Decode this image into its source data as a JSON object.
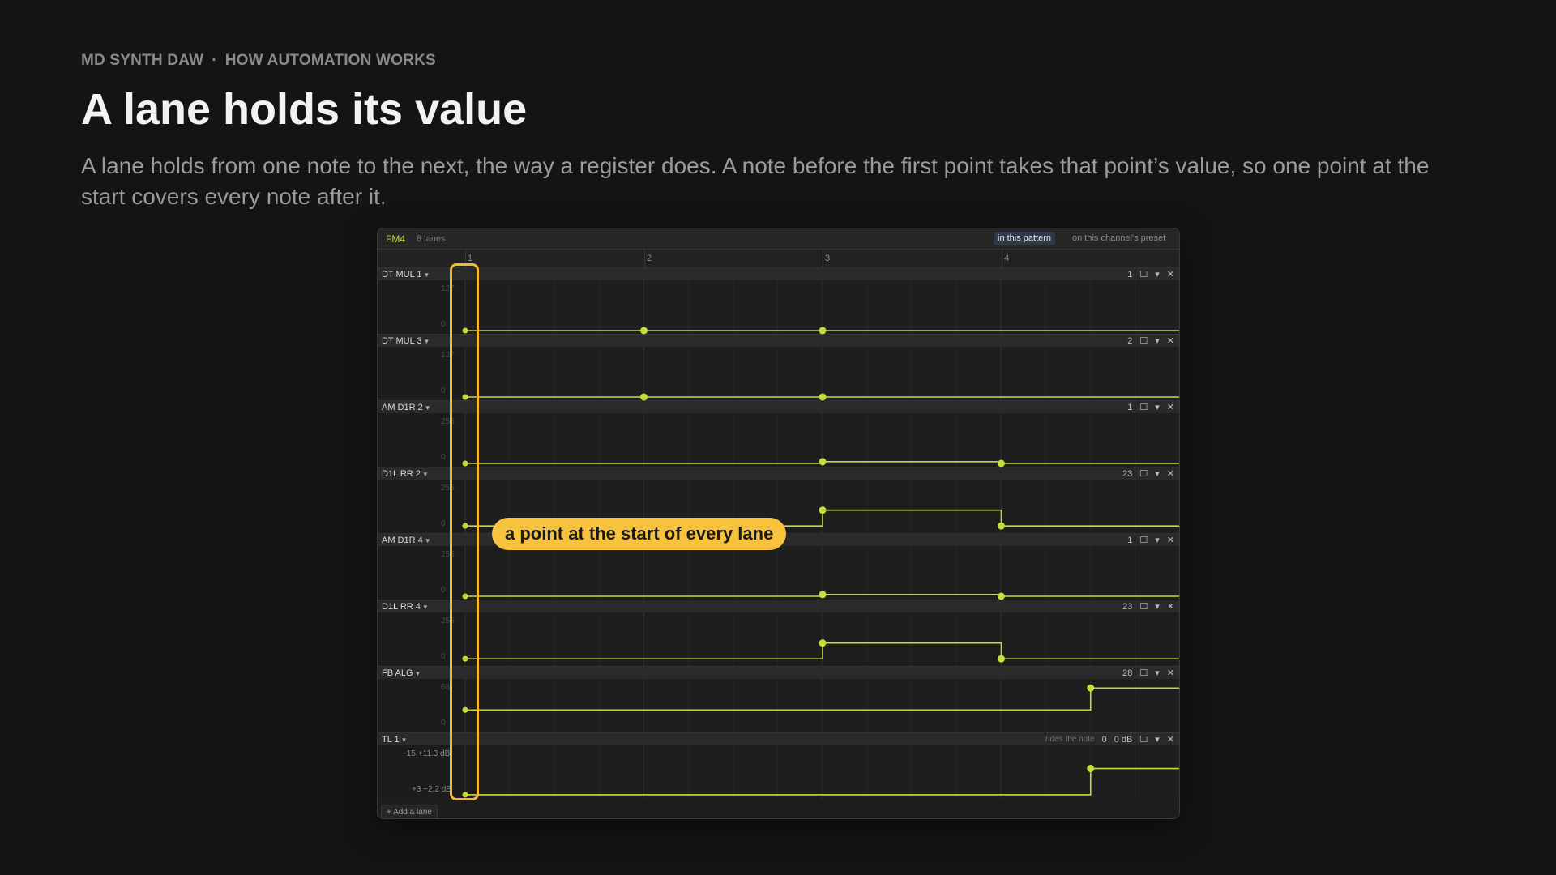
{
  "eyebrow": {
    "app": "MD SYNTH DAW",
    "sep": "·",
    "section": "HOW AUTOMATION WORKS"
  },
  "title": "A lane holds its value",
  "subtitle": "A lane holds from one note to the next, the way a register does. A note before the first point takes that point’s value, so one point at the start covers every note after it.",
  "panel": {
    "channel": "FM4",
    "lane_count": "8 lanes",
    "scope_active": "in this pattern",
    "scope_other": "on this channel's preset",
    "bars": [
      "1",
      "2",
      "3",
      "4"
    ],
    "add_lane": "+ Add a lane"
  },
  "colors": {
    "accent": "#c8dc3a",
    "callout": "#f7c23e",
    "background": "#141414"
  },
  "icons": {
    "dropdown": "caret-down-icon",
    "toggle": "square-icon",
    "menu": "chevron-down-icon",
    "remove": "close-icon"
  },
  "lanes": [
    {
      "name": "DT MUL 1",
      "val": "1",
      "max": "127",
      "min": "0",
      "points": [
        [
          1.0,
          0
        ],
        [
          2.0,
          0
        ],
        [
          3.0,
          0
        ]
      ]
    },
    {
      "name": "DT MUL 3",
      "val": "2",
      "max": "127",
      "min": "0",
      "points": [
        [
          1.0,
          0
        ],
        [
          2.0,
          0
        ],
        [
          3.0,
          0
        ]
      ]
    },
    {
      "name": "AM D1R 2",
      "val": "1",
      "max": "255",
      "min": "0",
      "points": [
        [
          1.0,
          0
        ],
        [
          3.0,
          0.04
        ],
        [
          4.0,
          0
        ]
      ]
    },
    {
      "name": "D1L RR 2",
      "val": "23",
      "max": "255",
      "min": "0",
      "points": [
        [
          1.0,
          0.09
        ],
        [
          3.0,
          0.45
        ],
        [
          4.0,
          0.09
        ]
      ]
    },
    {
      "name": "AM D1R 4",
      "val": "1",
      "max": "255",
      "min": "0",
      "points": [
        [
          1.0,
          0
        ],
        [
          3.0,
          0.04
        ],
        [
          4.0,
          0
        ]
      ]
    },
    {
      "name": "D1L RR 4",
      "val": "23",
      "max": "255",
      "min": "0",
      "points": [
        [
          1.0,
          0.09
        ],
        [
          3.0,
          0.45
        ],
        [
          4.0,
          0.09
        ]
      ]
    },
    {
      "name": "FB ALG",
      "val": "28",
      "max": "63",
      "min": "0",
      "points": [
        [
          1.0,
          0.44
        ],
        [
          4.5,
          0.94
        ]
      ]
    },
    {
      "name": "TL 1",
      "val": "0",
      "unit": "0 dB",
      "note": "rides the note",
      "max": "0",
      "min": "0",
      "tl_top": "−15  +11.3 dB",
      "tl_bot": "+3  −2.2 dB",
      "points": [
        [
          1.0,
          0.02
        ],
        [
          4.5,
          0.62
        ]
      ]
    }
  ],
  "callout": "a point at the start of every lane"
}
